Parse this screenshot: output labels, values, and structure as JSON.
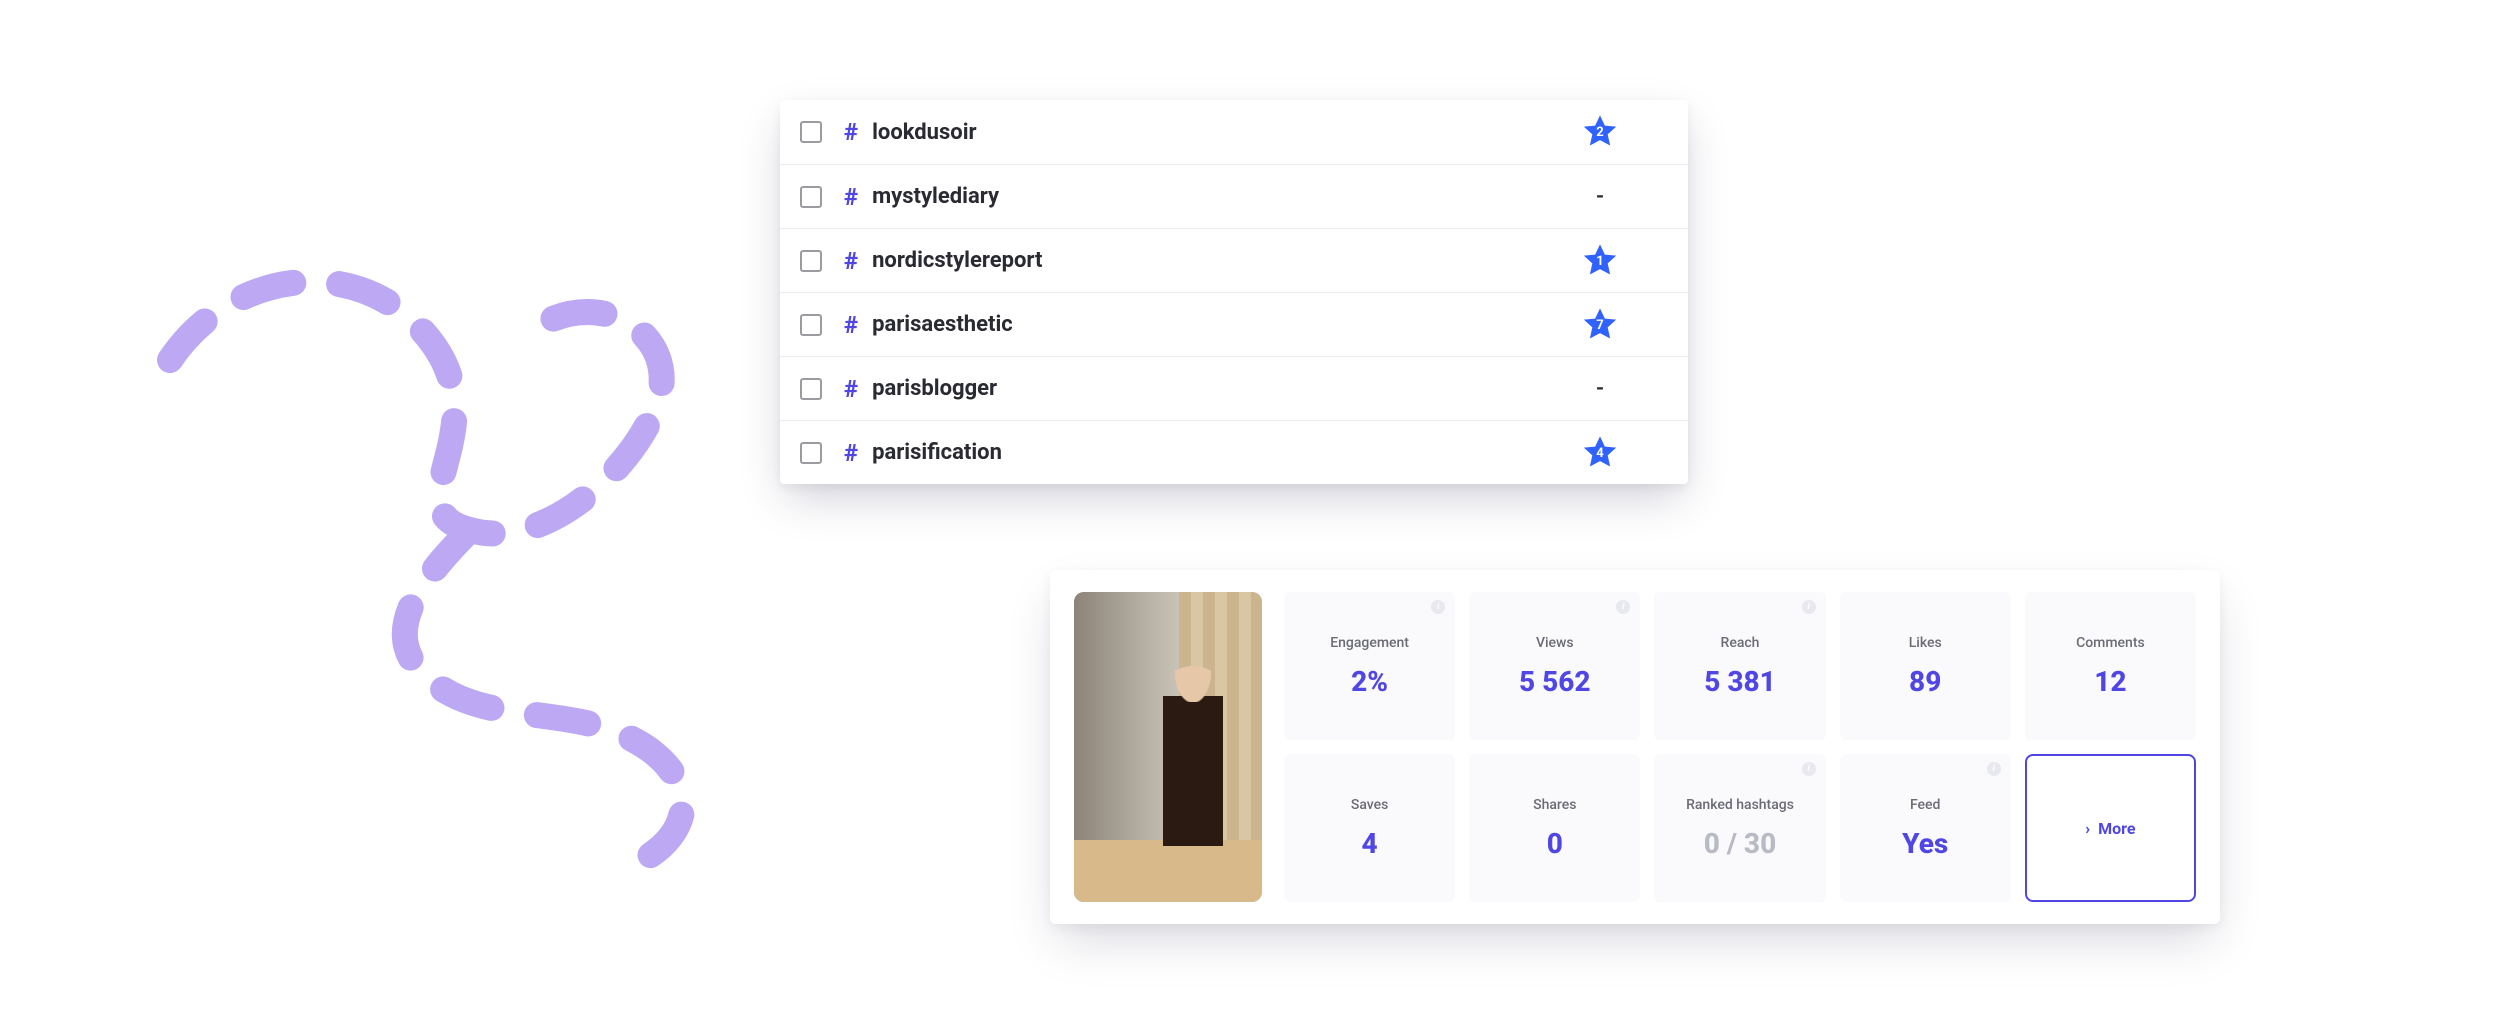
{
  "hashtags": [
    {
      "name": "lookdusoir",
      "rank": "2"
    },
    {
      "name": "mystylediary",
      "rank": null
    },
    {
      "name": "nordicstylereport",
      "rank": "1"
    },
    {
      "name": "parisaesthetic",
      "rank": "7"
    },
    {
      "name": "parisblogger",
      "rank": null
    },
    {
      "name": "parisification",
      "rank": "4"
    }
  ],
  "stats": {
    "engagement": {
      "label": "Engagement",
      "value": "2%",
      "info": true
    },
    "views": {
      "label": "Views",
      "value": "5 562",
      "info": true
    },
    "reach": {
      "label": "Reach",
      "value": "5 381",
      "info": true
    },
    "likes": {
      "label": "Likes",
      "value": "89",
      "info": false
    },
    "comments": {
      "label": "Comments",
      "value": "12",
      "info": false
    },
    "saves": {
      "label": "Saves",
      "value": "4",
      "info": false
    },
    "shares": {
      "label": "Shares",
      "value": "0",
      "info": false
    },
    "ranked": {
      "label": "Ranked hashtags",
      "value": "0 / 30",
      "info": true,
      "muted": true
    },
    "feed": {
      "label": "Feed",
      "value": "Yes",
      "info": true
    }
  },
  "more_label": "More",
  "colors": {
    "accent": "#4f46e5",
    "star": "#2f62ff",
    "squiggle": "#bda8f4"
  },
  "empty_rank": "-"
}
